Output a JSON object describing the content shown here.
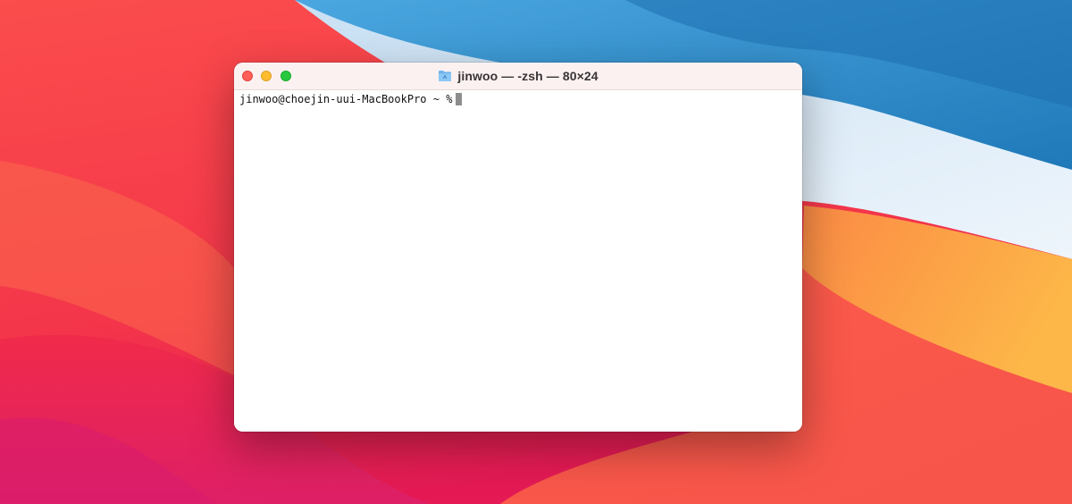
{
  "window": {
    "title": "jinwoo — -zsh — 80×24",
    "title_icon": "folder-icon"
  },
  "terminal": {
    "prompt": "jinwoo@choejin-uui-MacBookPro ~ %"
  },
  "colors": {
    "close": "#fe5f57",
    "minimize": "#febc2e",
    "zoom": "#28c840",
    "titlebar": "#fbf1f1",
    "cursor": "#8d8d8d"
  }
}
